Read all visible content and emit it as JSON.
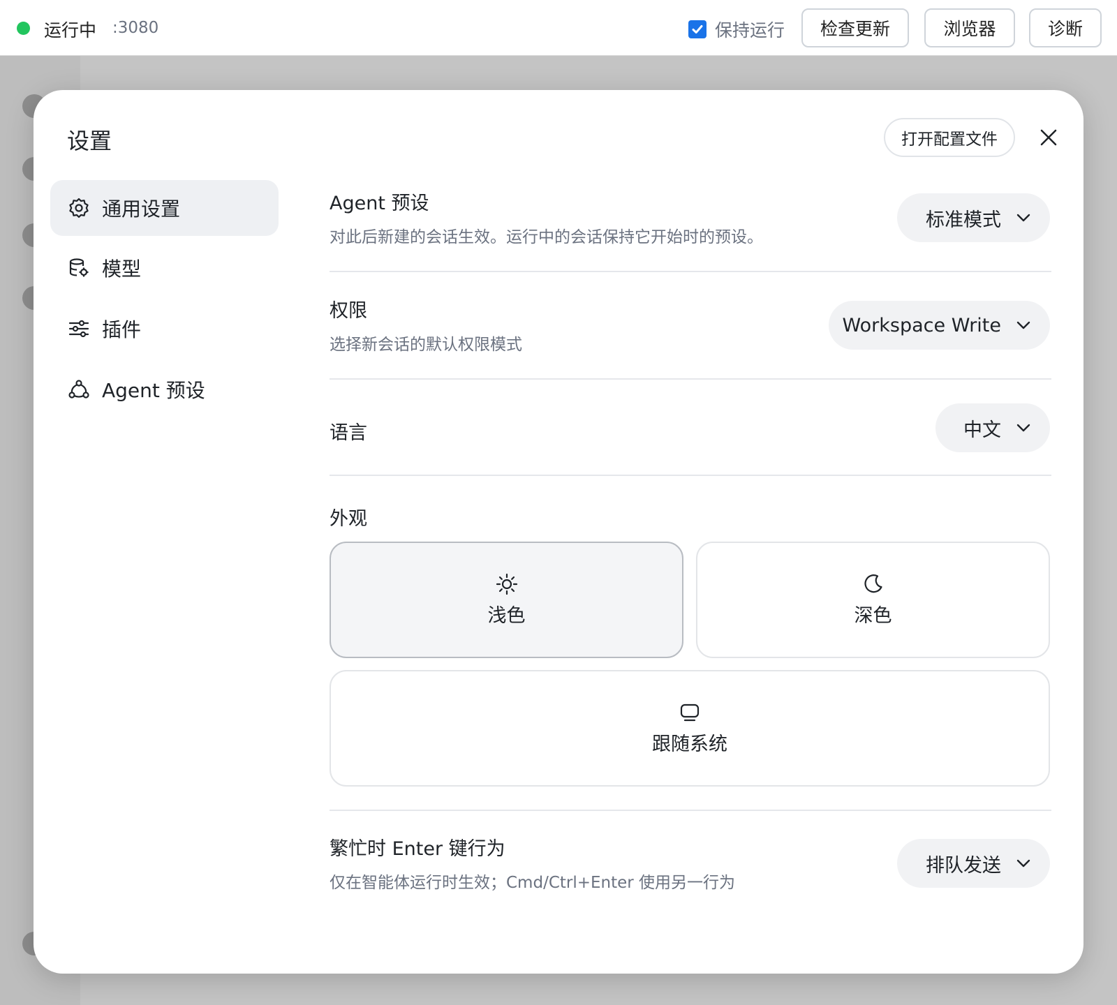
{
  "topbar": {
    "status": "运行中",
    "port": ":3080",
    "keep_running": "保持运行",
    "keep_running_checked": true,
    "check_update": "检查更新",
    "browser": "浏览器",
    "diagnose": "诊断",
    "status_color": "#22c55e",
    "accent_color": "#1a73e8"
  },
  "modal": {
    "title": "设置",
    "open_config": "打开配置文件",
    "close_icon": "close-icon"
  },
  "sidebar": {
    "items": [
      {
        "label": "通用设置",
        "icon": "gear-icon",
        "active": true
      },
      {
        "label": "模型",
        "icon": "database-gear-icon",
        "active": false
      },
      {
        "label": "插件",
        "icon": "sliders-icon",
        "active": false
      },
      {
        "label": "Agent 预设",
        "icon": "agent-nodes-icon",
        "active": false
      }
    ]
  },
  "settings": {
    "agent_preset": {
      "title": "Agent 预设",
      "desc": "对此后新建的会话生效。运行中的会话保持它开始时的预设。",
      "value": "标准模式"
    },
    "permission": {
      "title": "权限",
      "desc": "选择新会话的默认权限模式",
      "value": "Workspace Write"
    },
    "language": {
      "title": "语言",
      "value": "中文"
    },
    "appearance": {
      "title": "外观",
      "options": [
        {
          "label": "浅色",
          "icon": "sun-icon",
          "selected": true
        },
        {
          "label": "深色",
          "icon": "moon-icon",
          "selected": false
        },
        {
          "label": "跟随系统",
          "icon": "monitor-icon",
          "selected": false
        }
      ]
    },
    "busy_enter": {
      "title": "繁忙时 Enter 键行为",
      "desc": "仅在智能体运行时生效；Cmd/Ctrl+Enter 使用另一行为",
      "value": "排队发送"
    }
  }
}
